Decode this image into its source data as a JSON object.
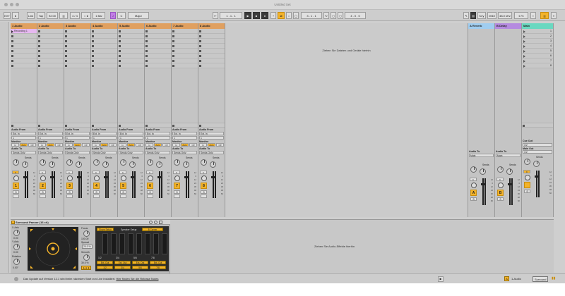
{
  "window": {
    "title": "Untitled Set"
  },
  "controlbar": {
    "link": "Link",
    "tap": "Tap",
    "tempo": "92.00",
    "signature": "4 / 4",
    "metro_mode": "1 Bar",
    "key": "C",
    "scale": "Major",
    "position": "1 . 1 . 1",
    "loop_start": "3 . 1 . 1",
    "loop_length": "4 . 0 . 0",
    "key_map": "Key",
    "midi_map": "MIDI",
    "sample_rate": "48.0 kHz",
    "cpu": "6 %",
    "accent_color": "#f3b32b",
    "key_color": "#c17ee6"
  },
  "session": {
    "tracks": [
      {
        "name": "1 Audio",
        "color": "#e0a060",
        "clip": "Recording 1"
      },
      {
        "name": "2 Audio",
        "color": "#e0a060"
      },
      {
        "name": "3 Audio",
        "color": "#e0a060"
      },
      {
        "name": "4 Audio",
        "color": "#e0a060"
      },
      {
        "name": "5 Audio",
        "color": "#e0a060"
      },
      {
        "name": "6 Audio",
        "color": "#e0a060"
      },
      {
        "name": "7 Audio",
        "color": "#e0a060"
      },
      {
        "name": "8 Audio",
        "color": "#e0a060"
      }
    ],
    "drop_hint": "Ziehen Sie Dateien und Geräte hierhin",
    "returns": [
      {
        "name": "A Reverb",
        "color": "#a0cdf0",
        "letter": "A",
        "audio_to_label": "Audio To",
        "audio_to": "Main"
      },
      {
        "name": "B Delay",
        "color": "#b58be0",
        "letter": "B",
        "audio_to_label": "Audio To",
        "audio_to": "Main"
      }
    ],
    "main": {
      "name": "Main",
      "color": "#6ad8c0",
      "scenes": [
        "1",
        "2",
        "3",
        "4",
        "5",
        "6",
        "7",
        "8"
      ],
      "cue_out_label": "Cue Out",
      "cue_out": "1/2",
      "main_out_label": "Main Out",
      "main_out": "1/2"
    },
    "io": {
      "audio_from_label": "Audio From",
      "audio_from": "Ext. In",
      "input_channel": "1",
      "monitor_label": "Monitor",
      "monitor_in": "In",
      "monitor_auto": "Auto",
      "monitor_off": "Off",
      "audio_to_label": "Audio To",
      "audio_to": "Sends Only",
      "sends_label": "Sends",
      "pan": "C",
      "vol": "-inf",
      "solo": "S",
      "meter_scale": [
        "12",
        "0",
        "12",
        "24",
        "36",
        "48",
        "60"
      ]
    }
  },
  "device": {
    "title": "Surround Panner (16 ch)",
    "xaxis_label": "X-Axis",
    "xaxis_val": "0.00",
    "yaxis_label": "Y-Axis",
    "yaxis_val": "0.00",
    "rotation_label": "Rotation",
    "rotation_val": "0.00°",
    "focus_label": "Focus",
    "focus_val": "100.00",
    "spread_label": "Spread",
    "spread_val": "20.0 %",
    "smooth_label": "Smooth",
    "smooth_val": "30.0 %",
    "speaker_setup_label": "Speaker Setup",
    "speaker_setup": "8 Corner",
    "share_setup": "Share Setup",
    "channels": [
      "1/2",
      "3/4",
      "5/6",
      "7/8"
    ],
    "outputs": [
      "Ext. Out",
      "Ext. Out",
      "Ext. Out",
      "Ext. Out"
    ],
    "output_pairs": [
      "1/2",
      "3/4",
      "5/6",
      "7/8"
    ],
    "drop_hint": "Ziehen Sie Audio-Effekte hierhin"
  },
  "status": {
    "message": "Das Update auf Version 12.1 wird beim nächsten Start von Live installiert.",
    "link": "Hier finden Sie die Release Notes",
    "track_indicator": "1-Audio",
    "view_label": "Surround"
  }
}
